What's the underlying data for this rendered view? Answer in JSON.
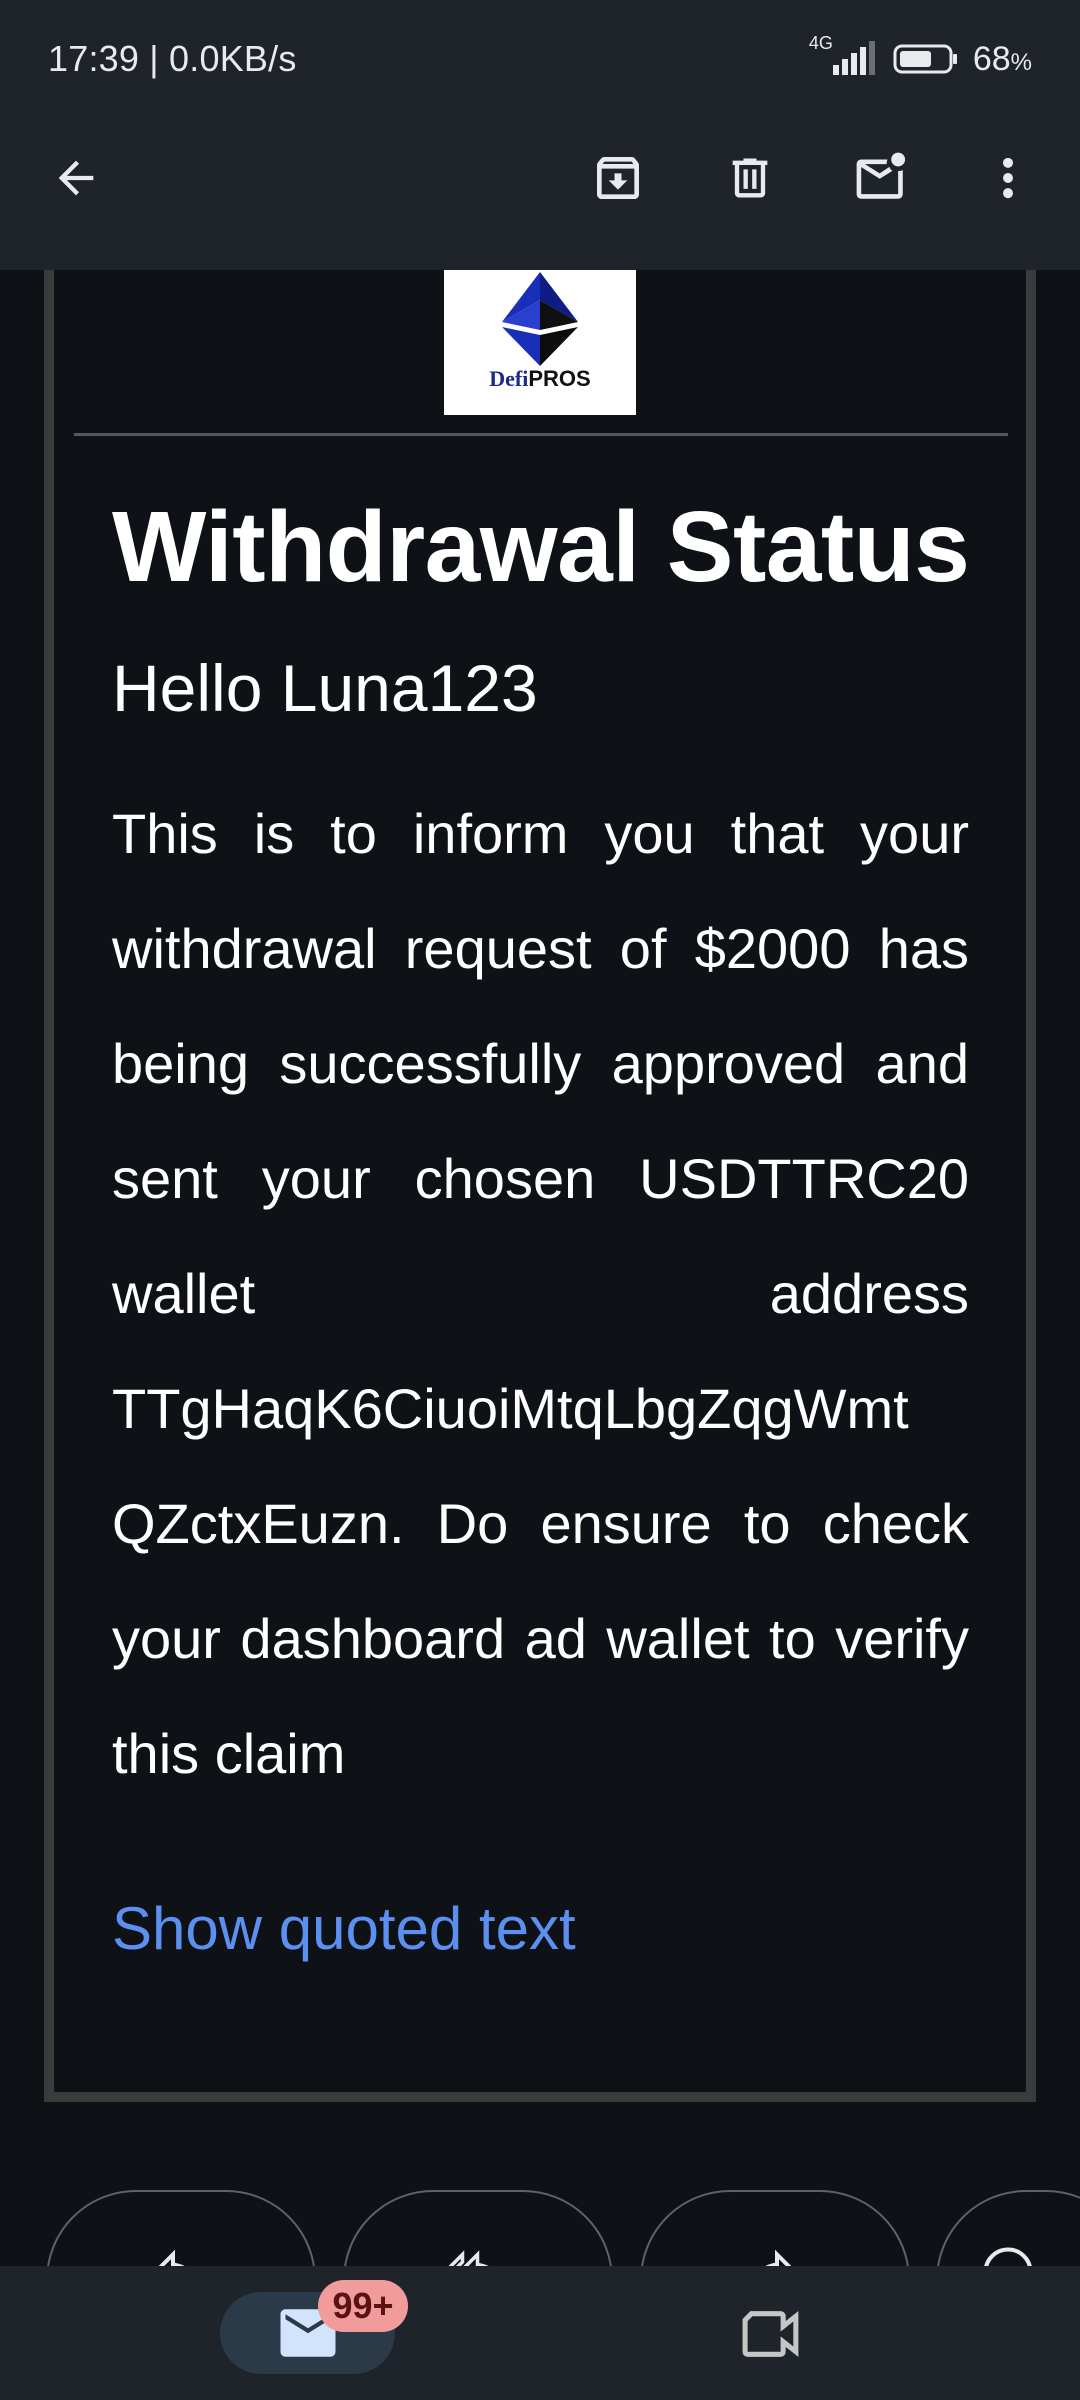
{
  "status_bar": {
    "time": "17:39 | 0.0KB/s",
    "network": "4G",
    "battery_percent": "68",
    "battery_percent_sign": "%",
    "battery_level": 0.68
  },
  "app_bar": {
    "back_icon": "arrow-left-icon",
    "archive_icon": "archive-icon",
    "delete_icon": "trash-icon",
    "mark_unread_icon": "mail-unread-icon",
    "more_icon": "more-vert-icon"
  },
  "email": {
    "logo_brand_part1": "Defi",
    "logo_brand_part2": "PROS",
    "title": "Withdrawal Status",
    "greeting": "Hello Luna123",
    "body": "This is to inform you that your withdrawal request of $2000 has being successfully approved and sent your chosen USDTTRC20 wallet address TTgHaqK6CiuoiMtqLbgZqgWmt QZctxEuzn. Do ensure to check your dashboard ad wallet to verify this claim",
    "show_quoted_text": "Show quoted text"
  },
  "actions": {
    "reply_icon": "reply-icon",
    "reply_all_icon": "reply-all-icon",
    "forward_icon": "forward-icon",
    "emoji_icon": "emoji-icon"
  },
  "bottom_nav": {
    "mail_icon": "mail-icon",
    "mail_badge": "99+",
    "meet_icon": "video-camera-icon"
  },
  "colors": {
    "background": "#0e1217",
    "bar_background": "#1f232a",
    "link": "#5b8ff0",
    "badge": "#f29b9b"
  }
}
